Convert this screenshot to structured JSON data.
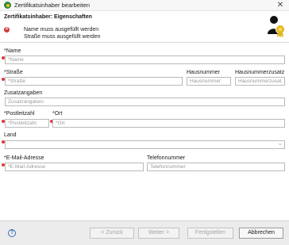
{
  "window": {
    "title": "Zertifikatsinhaber bearbeiten",
    "close_glyph": "✕"
  },
  "header": {
    "heading": "Zertifikatsinhaber: Eigenschaften",
    "errors": [
      "Name muss ausgefüllt werden",
      "Straße muss ausgefüllt werden"
    ],
    "icon": "certificate-user-icon"
  },
  "form": {
    "name": {
      "label": "*Name",
      "placeholder": "*Name",
      "value": ""
    },
    "street": {
      "label": "*Straße",
      "placeholder": "*Straße",
      "value": ""
    },
    "house_no": {
      "label": "Hausnummer",
      "placeholder": "Hausnummer",
      "value": ""
    },
    "house_no_suffix": {
      "label": "Hausnummerzusatz",
      "placeholder": "Hausnummerzusatz",
      "value": ""
    },
    "additional": {
      "label": "Zusatzangaben",
      "placeholder": "Zusatzangaben",
      "value": ""
    },
    "postal_code": {
      "label": "*Postleitzahl",
      "placeholder": "*Postleitzahl",
      "value": ""
    },
    "city": {
      "label": "*Ort",
      "placeholder": "*Ort",
      "value": ""
    },
    "country": {
      "label": "Land",
      "value": "",
      "arrow": "⌵"
    },
    "email": {
      "label": "*E-Mail-Adresse",
      "placeholder": "*E-Mail-Adresse",
      "value": ""
    },
    "phone": {
      "label": "Telefonnummer",
      "placeholder": "Telefonnummer",
      "value": ""
    }
  },
  "footer": {
    "help_glyph": "?",
    "back": "< Zurück",
    "next": "Weiter >",
    "finish": "Fertigstellen",
    "cancel": "Abbrechen"
  },
  "colors": {
    "required_marker": "#e03a3a",
    "error_icon": "#d13a3a",
    "help": "#3d6fb3"
  }
}
